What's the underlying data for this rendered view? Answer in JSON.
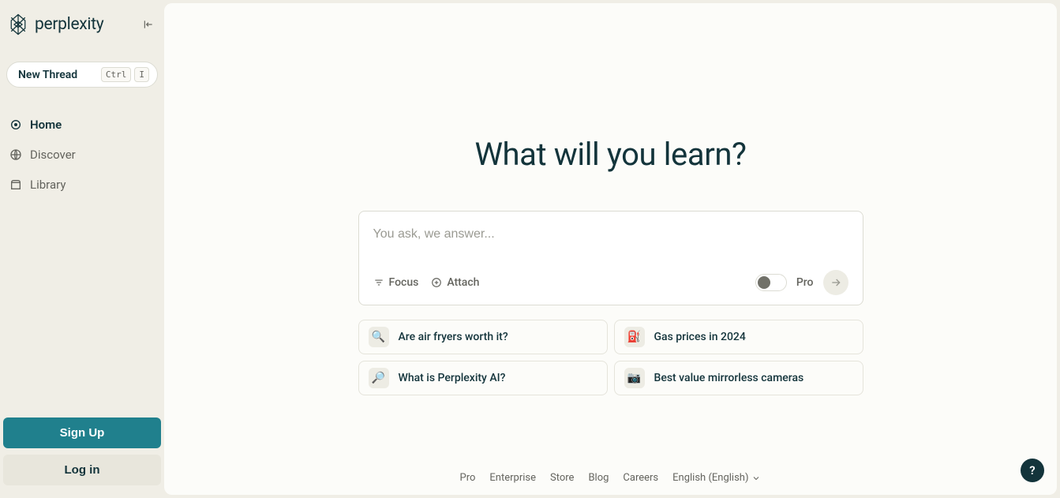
{
  "brand": "perplexity",
  "sidebar": {
    "new_thread_label": "New Thread",
    "kbd1": "Ctrl",
    "kbd2": "I",
    "nav": [
      {
        "label": "Home"
      },
      {
        "label": "Discover"
      },
      {
        "label": "Library"
      }
    ],
    "signup_label": "Sign Up",
    "login_label": "Log in"
  },
  "main": {
    "hero": "What will you learn?",
    "search_placeholder": "You ask, we answer...",
    "focus_label": "Focus",
    "attach_label": "Attach",
    "pro_label": "Pro",
    "suggestions": [
      {
        "emoji": "🔍",
        "text": "Are air fryers worth it?"
      },
      {
        "emoji": "⛽",
        "text": "Gas prices in 2024"
      },
      {
        "emoji": "🔎",
        "text": "What is Perplexity AI?"
      },
      {
        "emoji": "📷",
        "text": "Best value mirrorless cameras"
      }
    ]
  },
  "footer": {
    "links": [
      "Pro",
      "Enterprise",
      "Store",
      "Blog",
      "Careers"
    ],
    "language": "English (English)"
  },
  "help": "?"
}
